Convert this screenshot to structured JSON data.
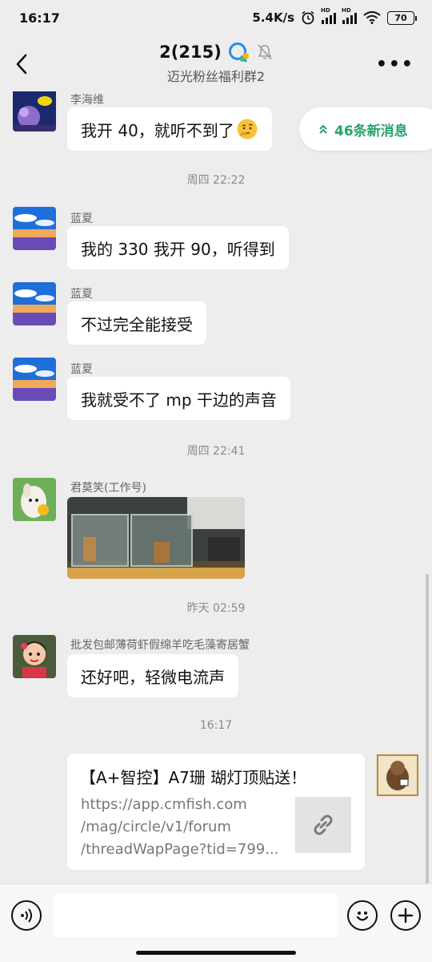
{
  "status": {
    "time": "16:17",
    "speed": "5.4K/s",
    "battery": "70",
    "hd": "HD"
  },
  "header": {
    "title": "2(215)",
    "subtitle": "迈光粉丝福利群2"
  },
  "new_messages": "46条新消息",
  "messages": [
    {
      "sender": "李海维",
      "text": "我开 40，就听不到了"
    },
    {
      "sender": "蓝夏",
      "text": "我的 330 我开 90，听得到"
    },
    {
      "sender": "蓝夏",
      "text": "不过完全能接受"
    },
    {
      "sender": "蓝夏",
      "text": "我就受不了 mp 干边的声音"
    },
    {
      "sender": "君莫笑(工作号)",
      "text": ""
    },
    {
      "sender": "批发包邮薄荷虾假绵羊吃毛藻寄居蟹",
      "text": "还好吧，轻微电流声"
    }
  ],
  "timestamps": [
    "周四 22:22",
    "周四 22:41",
    "昨天 02:59",
    "16:17"
  ],
  "link_card": {
    "title": "【A+智控】A7珊 瑚灯顶贴送！",
    "line1": "https://app.cmfish.com",
    "line2": "/mag/circle/v1/forum",
    "line3": "/threadWapPage?tid=799..."
  },
  "icons": {
    "back": "back-arrow-icon",
    "more": "more-icon",
    "voice": "voice-icon",
    "emoji": "emoji-icon",
    "plus": "plus-icon",
    "link": "link-icon"
  },
  "colors": {
    "accent_green": "#26a36a",
    "background": "#ededed",
    "bubble": "#ffffff"
  }
}
